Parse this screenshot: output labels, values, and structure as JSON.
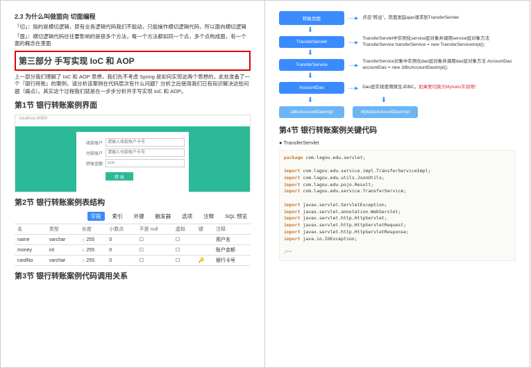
{
  "left": {
    "h23": "2.3 为什么叫做面向 切面编程",
    "p1": "「切」：指的是横切逻辑，原有业务逻辑代码我们不能动，只能操作横切逻辑代码，所以面向横切逻辑",
    "p2": "「面」：横切逻辑代码往往要影响的是很多个方法，每一个方法都如同一个点，多个点构成面，有一个面的概念在里面",
    "part3": "第三部分 手写实现 IoC 和 AOP",
    "p3": "上一部分我们理解了 IoC 和 AOP 思想，我们先不考虑 Spring 是如何实现这两个思想的，此处准备了一个『银行转账』的案例，请分析该案例在代码层次有什么问题？分析之后使用我们已有知识解决这些问题（痛点）。其实这个过程我们就是在一步步分析并手写实现 IoC 和 AOP。",
    "s1": "第1节 银行转账案例界面",
    "url": "localhost:8080/",
    "form": {
      "l1": "收款账户",
      "ph1": "请输入收款账户卡号",
      "l2": "付款账户",
      "ph2": "请输入付款账户卡号",
      "l3": "转账金额",
      "ph3": "100",
      "btn": "转 出"
    },
    "s2": "第2节 银行转账案例表结构",
    "tabs": [
      "字段",
      "索引",
      "外键",
      "触发器",
      "选项",
      "注释",
      "SQL 预览"
    ],
    "th": [
      "名",
      "类型",
      "长度",
      "小数点",
      "不是 null",
      "虚拟",
      "键",
      "注释"
    ],
    "rows": [
      [
        "name",
        "varchar",
        "255",
        "0",
        "",
        "",
        "",
        "用户名"
      ],
      [
        "money",
        "int",
        "255",
        "0",
        "",
        "",
        "",
        "账户金额"
      ],
      [
        "cardNo",
        "varchar",
        "255",
        "0",
        "",
        "",
        "🔑",
        "银行卡号"
      ]
    ],
    "s3": "第3节 银行转账案例代码调用关系"
  },
  "right": {
    "diag": [
      {
        "box": "转账页面",
        "txt": "点击\"转出\"，页面发起ajax请求到TransferServlet"
      },
      {
        "box": "TransferServlet",
        "txt": "TransferServlet中实例化service层对象并调用service层对象方法\nTransferService transferService\n        = new TransferServiceImpl();"
      },
      {
        "box": "TransferService",
        "txt": "TransferService对象中实例化dao层对象并调用dao层对象方法\nAccountDao accountDao\n        = new JdbcAccountDaoImpl();"
      },
      {
        "box": "AccountDao",
        "txt": "Dao层实现使用原生JDBC，",
        "red": "如果要切换为Mybatis实现呢!"
      }
    ],
    "leaf1": "JdbcAccountDaoImpl",
    "leaf2": "MybatisAccountDaoImpl",
    "s4": "第4节 银行转账案例关键代码",
    "bullet": "TransferServlet",
    "code": {
      "pkg": "package com.lagou.edu.servlet;",
      "imp": [
        "import com.lagou.edu.service.impl.TransferServiceImpl;",
        "import com.lagou.edu.utils.JsonUtils;",
        "import com.lagou.edu.pojo.Result;",
        "import com.lagou.edu.service.TransferService;",
        "",
        "import javax.servlet.ServletException;",
        "import javax.servlet.annotation.WebServlet;",
        "import javax.servlet.http.HttpServlet;",
        "import javax.servlet.http.HttpServletRequest;",
        "import javax.servlet.http.HttpServletResponse;",
        "import java.io.IOException;"
      ],
      "cm": "/**"
    }
  }
}
